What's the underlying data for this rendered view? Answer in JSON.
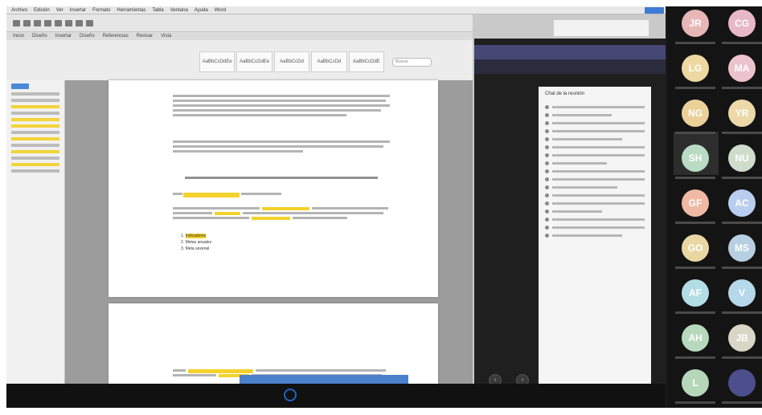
{
  "menubar": {
    "items": [
      "Archivo",
      "Edición",
      "Ver",
      "Insertar",
      "Formato",
      "Herramientas",
      "Tabla",
      "Ventana",
      "Ayuda"
    ],
    "word": "Word"
  },
  "ribbon": {
    "tabs": [
      "Inicio",
      "Diseño",
      "Insertar",
      "Diseño",
      "Referencias",
      "Revisar",
      "Vista"
    ],
    "styles": [
      "AaBbCcDdEe",
      "AaBbCcDdEe",
      "AaBbCcDd",
      "AaBbCcDd",
      "AaBbCcDdE"
    ],
    "search_placeholder": "Buscar"
  },
  "document": {
    "bullets": [
      "Indicadores",
      "Metas anuales",
      "Meta sexenal"
    ]
  },
  "teams": {
    "chat_title": "Chat de la reunión"
  },
  "participants": [
    {
      "initials": "JR",
      "color": "#e7b6b6"
    },
    {
      "initials": "CG",
      "color": "#e9b8c8"
    },
    {
      "initials": "LG",
      "color": "#ecd8a0"
    },
    {
      "initials": "MA",
      "color": "#ecc3cd"
    },
    {
      "initials": "NG",
      "color": "#ecd09a"
    },
    {
      "initials": "YR",
      "color": "#ecd8a8"
    },
    {
      "initials": "SH",
      "color": "#b9dbc3"
    },
    {
      "initials": "NU",
      "color": "#cfdccc"
    },
    {
      "initials": "GF",
      "color": "#efb9a4"
    },
    {
      "initials": "AC",
      "color": "#b8cdef"
    },
    {
      "initials": "GO",
      "color": "#e9d6a2"
    },
    {
      "initials": "MS",
      "color": "#b7cfe1"
    },
    {
      "initials": "AF",
      "color": "#b3dde5"
    },
    {
      "initials": "V",
      "color": "#b5d8ea"
    },
    {
      "initials": "AH",
      "color": "#b6d8bd"
    },
    {
      "initials": "JB",
      "color": "#d7d7c7"
    },
    {
      "initials": "L",
      "color": "#b6d6ba"
    },
    {
      "initials": "",
      "color": "#4c4f8c"
    }
  ]
}
